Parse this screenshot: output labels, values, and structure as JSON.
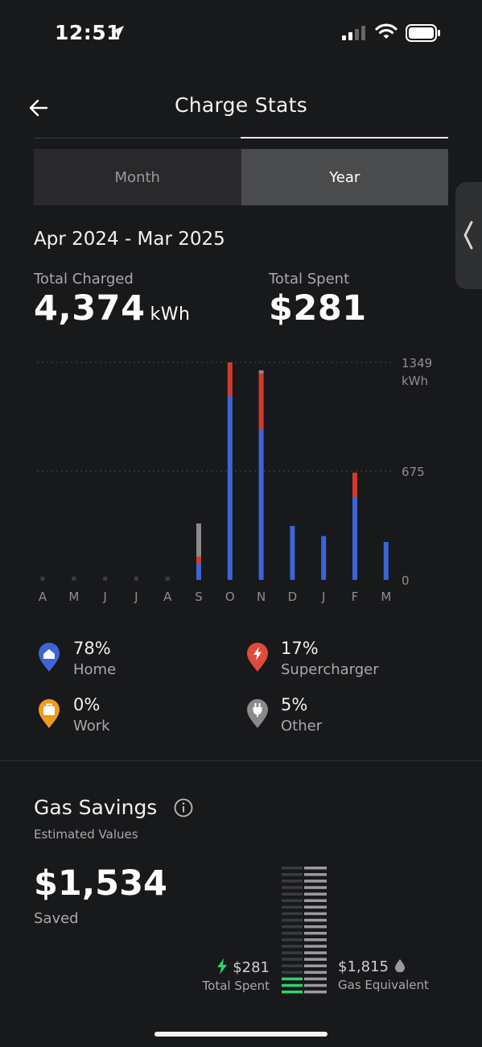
{
  "status_bar": {
    "time": "12:51"
  },
  "header": {
    "title": "Charge Stats",
    "back_icon": "back-arrow-icon"
  },
  "tabs": [
    {
      "label": "Month",
      "active": false
    },
    {
      "label": "Year",
      "active": true
    }
  ],
  "period": "Apr 2024 - Mar 2025",
  "totals": {
    "charged_label": "Total Charged",
    "charged_value": "4,374",
    "charged_unit": "kWh",
    "spent_label": "Total Spent",
    "spent_value": "$281"
  },
  "chart_data": {
    "type": "bar",
    "stacked": true,
    "categories": [
      "A",
      "M",
      "J",
      "J",
      "A",
      "S",
      "O",
      "N",
      "D",
      "J",
      "F",
      "M"
    ],
    "series": [
      {
        "name": "Home",
        "color": "#3e64d8",
        "values": [
          0,
          0,
          0,
          0,
          0,
          100,
          1140,
          935,
          335,
          272,
          515,
          235
        ]
      },
      {
        "name": "Supercharger",
        "color": "#d23a2e",
        "values": [
          0,
          0,
          0,
          0,
          0,
          45,
          209,
          345,
          0,
          0,
          150,
          0
        ]
      },
      {
        "name": "Other",
        "color": "#8a8a8c",
        "values": [
          0,
          0,
          0,
          0,
          0,
          205,
          0,
          20,
          0,
          0,
          0,
          0
        ]
      }
    ],
    "ticks": [
      "1349",
      "675",
      "0"
    ],
    "tick_values": [
      1349,
      675,
      0
    ],
    "y_unit": "kWh",
    "ylim": [
      0,
      1349
    ],
    "gridlines": "dotted"
  },
  "legend": [
    {
      "pct": "78%",
      "name": "Home",
      "color": "#3e64d8",
      "icon": "home-icon"
    },
    {
      "pct": "17%",
      "name": "Supercharger",
      "color": "#e04a3b",
      "icon": "bolt-icon"
    },
    {
      "pct": "0%",
      "name": "Work",
      "color": "#f29a1e",
      "icon": "briefcase-icon"
    },
    {
      "pct": "5%",
      "name": "Other",
      "color": "#8a8a8c",
      "icon": "plug-icon"
    }
  ],
  "gas_savings": {
    "title": "Gas Savings",
    "subtitle": "Estimated Values",
    "saved_value": "$1,534",
    "saved_label": "Saved",
    "spent_value": "$281",
    "spent_label": "Total Spent",
    "gas_value": "$1,815",
    "gas_label": "Gas Equivalent",
    "spent_share": 0.155
  }
}
